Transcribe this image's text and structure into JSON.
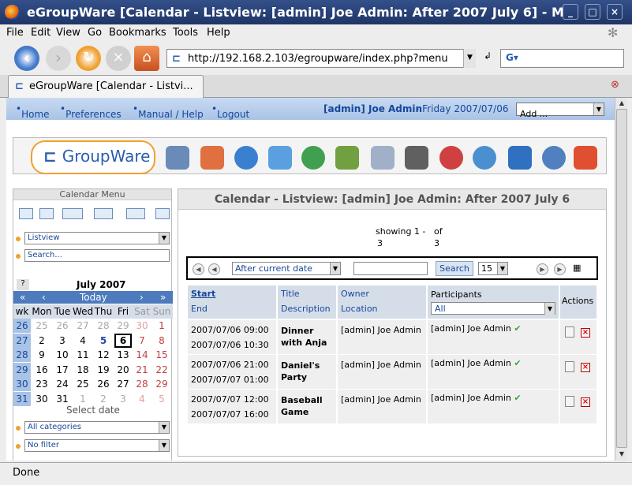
{
  "window": {
    "title": "eGroupWare [Calendar - Listview: [admin] Joe Admin: After 2007 July 6] - Mozilla Firefox"
  },
  "menubar": [
    "File",
    "Edit",
    "View",
    "Go",
    "Bookmarks",
    "Tools",
    "Help"
  ],
  "address": {
    "url": "http://192.168.2.103/egroupware/index.php?menu"
  },
  "tab": {
    "label": "eGroupWare [Calendar - Listvi..."
  },
  "topnav": {
    "home": "Home",
    "preferences": "Preferences",
    "manual": "Manual / Help",
    "logout": "Logout",
    "user": "[admin] Joe Admin",
    "date": " - Friday 2007/07/06",
    "add": "Add ..."
  },
  "logo": {
    "text": "GroupWare"
  },
  "sidebar": {
    "title": "Calendar Menu",
    "view": "Listview",
    "search_placeholder": "Search...",
    "month": "July 2007",
    "help": "?",
    "nav": {
      "prev_year": "«",
      "prev": "‹",
      "today": "Today",
      "next": "›",
      "next_year": "»"
    },
    "weekday_header": [
      "wk",
      "Mon",
      "Tue",
      "Wed",
      "Thu",
      "Fri",
      "Sat",
      "Sun"
    ],
    "weeks": [
      {
        "wk": "26",
        "days": [
          "25",
          "26",
          "27",
          "28",
          "29",
          "30",
          "1"
        ]
      },
      {
        "wk": "27",
        "days": [
          "2",
          "3",
          "4",
          "5",
          "6",
          "7",
          "8"
        ]
      },
      {
        "wk": "28",
        "days": [
          "9",
          "10",
          "11",
          "12",
          "13",
          "14",
          "15"
        ]
      },
      {
        "wk": "29",
        "days": [
          "16",
          "17",
          "18",
          "19",
          "20",
          "21",
          "22"
        ]
      },
      {
        "wk": "30",
        "days": [
          "23",
          "24",
          "25",
          "26",
          "27",
          "28",
          "29"
        ]
      },
      {
        "wk": "31",
        "days": [
          "30",
          "31",
          "1",
          "2",
          "3",
          "4",
          "5"
        ]
      }
    ],
    "select_date": "Select date",
    "categories": "All categories",
    "filter": "No filter"
  },
  "main": {
    "title": "Calendar - Listview: [admin] Joe Admin: After 2007 July 6",
    "showing_prefix": "showing 1 -",
    "showing_to": "3",
    "showing_of": "of",
    "showing_total": "3",
    "date_filter": "After current date",
    "search_button": "Search",
    "per_page": "15",
    "columns": {
      "start": "Start",
      "end": "End",
      "title": "Title",
      "description": "Description",
      "owner": "Owner",
      "location": "Location",
      "participants": "Participants",
      "participants_filter": "All",
      "actions": "Actions"
    },
    "rows": [
      {
        "start": "2007/07/06 09:00",
        "end": "2007/07/06 10:30",
        "title": "Dinner with Anja",
        "owner": "[admin] Joe Admin",
        "participant": "[admin] Joe Admin"
      },
      {
        "start": "2007/07/06 21:00",
        "end": "2007/07/07 01:00",
        "title": "Daniel's Party",
        "owner": "[admin] Joe Admin",
        "participant": "[admin] Joe Admin"
      },
      {
        "start": "2007/07/07 12:00",
        "end": "2007/07/07 16:00",
        "title": "Baseball Game",
        "owner": "[admin] Joe Admin",
        "participant": "[admin] Joe Admin"
      }
    ]
  },
  "statusbar": {
    "text": "Done"
  }
}
